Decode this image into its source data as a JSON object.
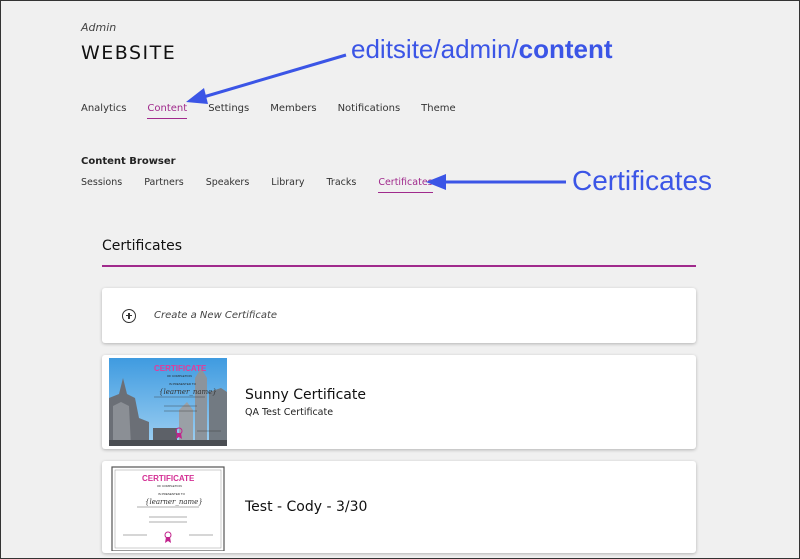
{
  "header": {
    "admin_label": "Admin",
    "site_title": "WEBSITE"
  },
  "nav": {
    "items": [
      "Analytics",
      "Content",
      "Settings",
      "Members",
      "Notifications",
      "Theme"
    ],
    "active": "Content"
  },
  "content_browser": {
    "title": "Content Browser",
    "tabs": [
      "Sessions",
      "Partners",
      "Speakers",
      "Library",
      "Tracks",
      "Certificates"
    ],
    "active": "Certificates"
  },
  "section": {
    "title": "Certificates"
  },
  "create": {
    "label": "Create a New Certificate",
    "icon": "plus-circle-icon"
  },
  "certificates": [
    {
      "name": "Sunny Certificate",
      "description": "QA Test Certificate",
      "thumb": {
        "heading": "CERTIFICATE",
        "sub": "OF COMPLETION",
        "presented": "IS PRESENTED TO",
        "learner": "{learner_name}"
      }
    },
    {
      "name": "Test - Cody - 3/30",
      "description": "",
      "thumb": {
        "heading": "CERTIFICATE",
        "sub": "OF COMPLETION",
        "presented": "IS PRESENTED TO",
        "learner": "{learner_name}"
      }
    }
  ],
  "annotations": {
    "content_path_prefix": "editsite/admin/",
    "content_path_bold": "content",
    "certificates": "Certificates"
  },
  "colors": {
    "accent": "#a02a8c",
    "annotation": "#3b55e6",
    "background": "#f0f0f0"
  }
}
